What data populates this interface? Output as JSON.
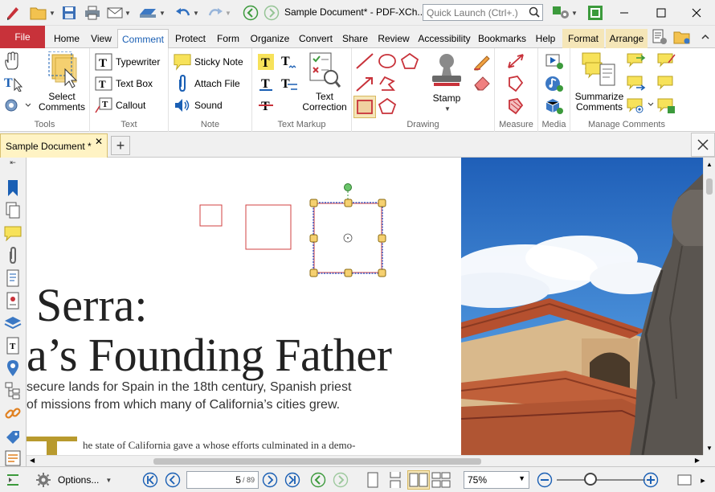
{
  "titlebar": {
    "title": "Sample Document* - PDF-XCh..",
    "quick_launch_placeholder": "Quick Launch (Ctrl+.)"
  },
  "menu_tabs": [
    "File",
    "Home",
    "View",
    "Comment",
    "Protect",
    "Form",
    "Organize",
    "Convert",
    "Share",
    "Review",
    "Accessibility",
    "Bookmarks",
    "Help",
    "Format",
    "Arrange"
  ],
  "active_tab": "Comment",
  "ribbon": {
    "tools": {
      "label": "Tools"
    },
    "select_comments": {
      "line1": "Select",
      "line2": "Comments"
    },
    "text": {
      "label": "Text",
      "typewriter": "Typewriter",
      "text_box": "Text Box",
      "callout": "Callout"
    },
    "note": {
      "label": "Note",
      "sticky_note": "Sticky Note",
      "attach_file": "Attach File",
      "sound": "Sound"
    },
    "text_markup": {
      "label": "Text Markup",
      "text_correction_1": "Text",
      "text_correction_2": "Correction"
    },
    "drawing": {
      "label": "Drawing",
      "stamp": "Stamp"
    },
    "measure": {
      "label": "Measure"
    },
    "media": {
      "label": "Media"
    },
    "manage_comments": {
      "label": "Manage Comments",
      "summarize_1": "Summarize",
      "summarize_2": "Comments"
    }
  },
  "doctab": {
    "title": "Sample Document *"
  },
  "document": {
    "heading1": "Serra:",
    "heading2": "a’s Founding Father",
    "sub1": "secure lands for Spain in the 18th century, Spanish priest",
    "sub2": "of missions from which many of California’s cities grew.",
    "body1": "he state of California gave a    whose efforts culminated in a demo-"
  },
  "statusbar": {
    "options": "Options...",
    "current_page": "5",
    "total_pages": "/ 89",
    "zoom": "75%"
  },
  "colors": {
    "file_tab": "#c8323a",
    "accent_blue": "#1a5fb4",
    "annotation_red": "#d04040",
    "handle": "#f5d070"
  }
}
